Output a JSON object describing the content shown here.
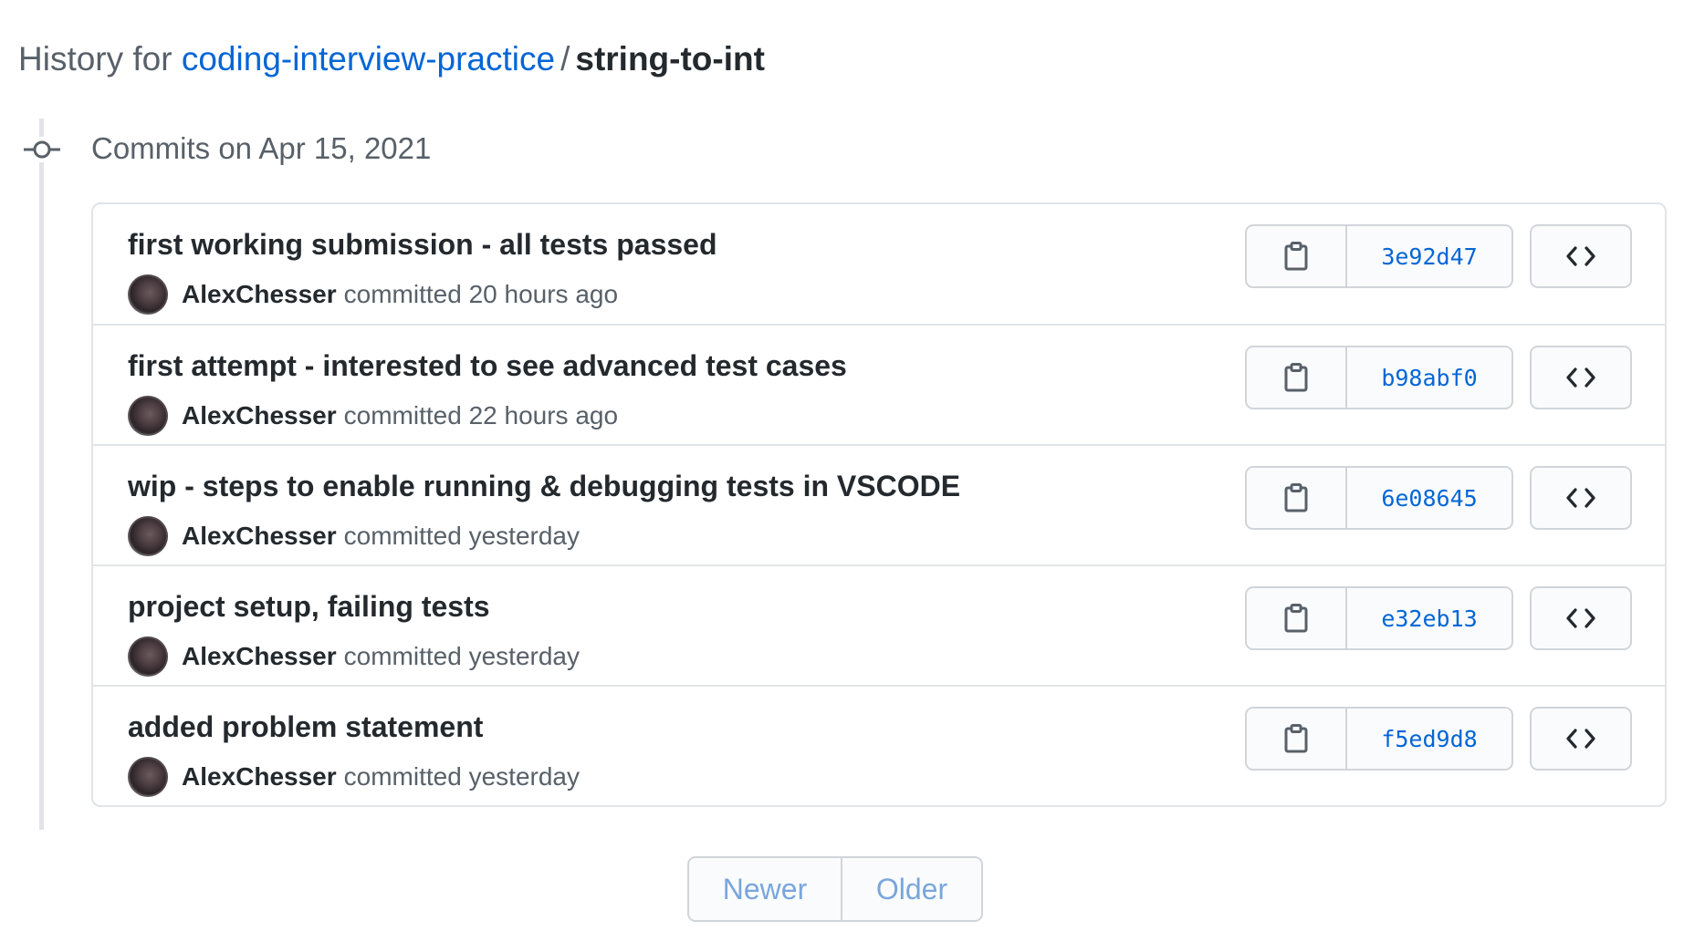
{
  "header": {
    "prefix": "History for",
    "repo_name": "coding-interview-practice",
    "separator": "/",
    "file_name": "string-to-int"
  },
  "commit_group": {
    "title": "Commits on Apr 15, 2021",
    "icon": "git-commit-icon"
  },
  "commits": [
    {
      "message": "first working submission - all tests passed",
      "author": "AlexChesser",
      "action": "committed",
      "time": "20 hours ago",
      "sha": "3e92d47"
    },
    {
      "message": "first attempt - interested to see advanced test cases",
      "author": "AlexChesser",
      "action": "committed",
      "time": "22 hours ago",
      "sha": "b98abf0"
    },
    {
      "message": "wip - steps to enable running & debugging tests in VSCODE",
      "author": "AlexChesser",
      "action": "committed",
      "time": "yesterday",
      "sha": "6e08645"
    },
    {
      "message": "project setup, failing tests",
      "author": "AlexChesser",
      "action": "committed",
      "time": "yesterday",
      "sha": "e32eb13"
    },
    {
      "message": "added problem statement",
      "author": "AlexChesser",
      "action": "committed",
      "time": "yesterday",
      "sha": "f5ed9d8"
    }
  ],
  "icons": {
    "copy": "clipboard-icon",
    "browse": "code-icon"
  },
  "pagination": {
    "newer_label": "Newer",
    "older_label": "Older"
  },
  "colors": {
    "link": "#0366d6",
    "border": "#e1e4e8",
    "muted_text": "#586069",
    "disabled_link": "#79a6dc"
  }
}
